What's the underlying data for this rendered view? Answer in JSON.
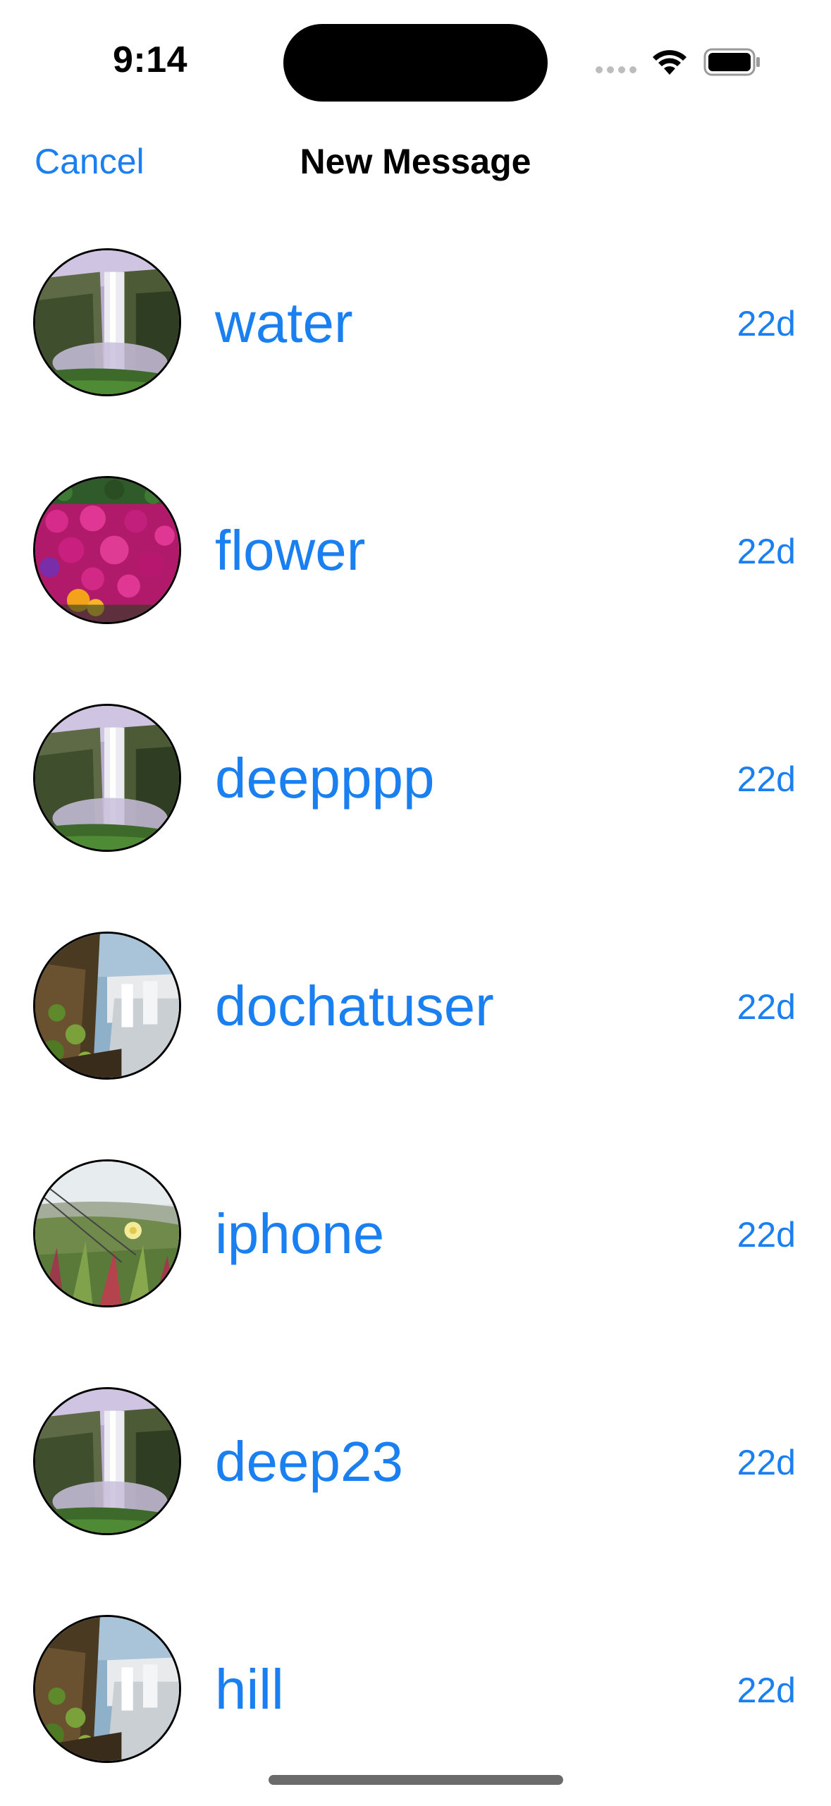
{
  "status_bar": {
    "time": "9:14"
  },
  "nav": {
    "cancel_label": "Cancel",
    "title": "New Message"
  },
  "accent_color": "#1a7ff0",
  "users": [
    {
      "name": "water",
      "time": "22d",
      "avatar": "waterfall-misty"
    },
    {
      "name": "flower",
      "time": "22d",
      "avatar": "pink-flowers"
    },
    {
      "name": "deepppp",
      "time": "22d",
      "avatar": "waterfall-misty"
    },
    {
      "name": "dochatuser",
      "time": "22d",
      "avatar": "waterfall-cliff"
    },
    {
      "name": "iphone",
      "time": "22d",
      "avatar": "plants-field"
    },
    {
      "name": "deep23",
      "time": "22d",
      "avatar": "waterfall-misty"
    },
    {
      "name": "hill",
      "time": "22d",
      "avatar": "waterfall-cliff"
    }
  ]
}
